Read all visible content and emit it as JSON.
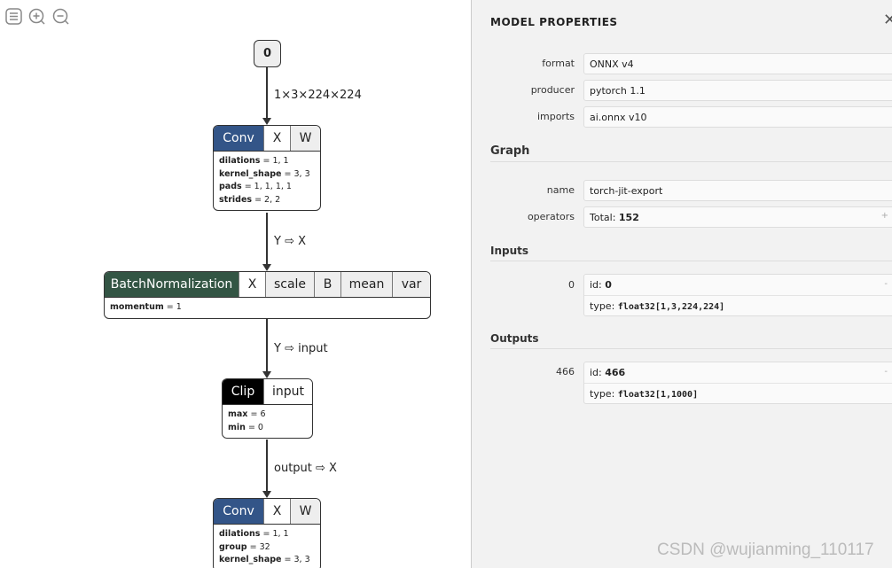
{
  "toolbar": {
    "icons": [
      "menu-icon",
      "zoom-in-icon",
      "zoom-out-icon"
    ]
  },
  "graph": {
    "input_node": "0",
    "edges": [
      "1×3×224×224",
      "Y ⇨ X",
      "Y ⇨ input",
      "output ⇨ X"
    ],
    "nodes": [
      {
        "op": "Conv",
        "color": "#335588",
        "inputs": [
          "X",
          "W"
        ],
        "attrs": [
          [
            "dilations",
            "1, 1"
          ],
          [
            "kernel_shape",
            "3, 3"
          ],
          [
            "pads",
            "1, 1, 1, 1"
          ],
          [
            "strides",
            "2, 2"
          ]
        ]
      },
      {
        "op": "BatchNormalization",
        "color": "#335544",
        "inputs": [
          "X",
          "scale",
          "B",
          "mean",
          "var"
        ],
        "attrs": [
          [
            "momentum",
            "1"
          ]
        ]
      },
      {
        "op": "Clip",
        "color": "#000000",
        "inputs": [
          "input"
        ],
        "attrs": [
          [
            "max",
            "6"
          ],
          [
            "min",
            "0"
          ]
        ]
      },
      {
        "op": "Conv",
        "color": "#335588",
        "inputs": [
          "X",
          "W"
        ],
        "attrs": [
          [
            "dilations",
            "1, 1"
          ],
          [
            "group",
            "32"
          ],
          [
            "kernel_shape",
            "3, 3"
          ]
        ]
      }
    ]
  },
  "panel": {
    "title": "MODEL PROPERTIES",
    "close": "✕",
    "props": [
      {
        "label": "format",
        "value": "ONNX v4"
      },
      {
        "label": "producer",
        "value": "pytorch 1.1"
      },
      {
        "label": "imports",
        "value": "ai.onnx v10"
      }
    ],
    "graph_section": "Graph",
    "graph_props": [
      {
        "label": "name",
        "value": "torch-jit-export"
      },
      {
        "label": "operators",
        "prefix": "Total: ",
        "value": "152",
        "expand": "+"
      }
    ],
    "inputs_section": "Inputs",
    "inputs": [
      {
        "label": "0",
        "id_prefix": "id: ",
        "id": "0",
        "type_prefix": "type: ",
        "type": "float32[1,3,224,224]",
        "collapse": "-"
      }
    ],
    "outputs_section": "Outputs",
    "outputs": [
      {
        "label": "466",
        "id_prefix": "id: ",
        "id": "466",
        "type_prefix": "type: ",
        "type": "float32[1,1000]",
        "collapse": "-"
      }
    ]
  },
  "watermark": "CSDN @wujianming_110117"
}
